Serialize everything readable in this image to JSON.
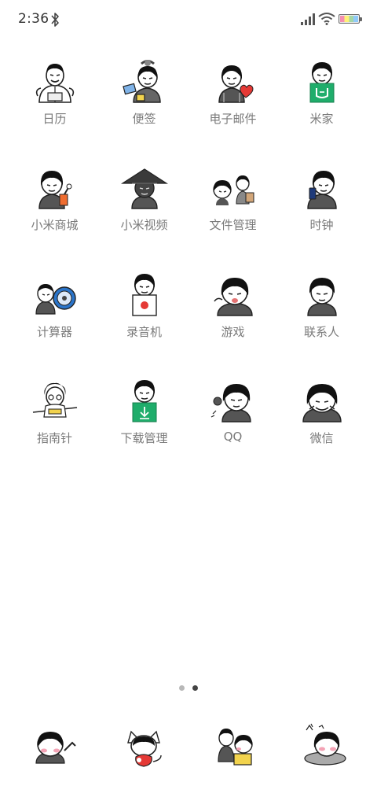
{
  "status_bar": {
    "time": "2:36",
    "icons": [
      "bluetooth-icon",
      "signal-icon",
      "wifi-icon",
      "battery-icon"
    ]
  },
  "apps": [
    {
      "label": "日历",
      "icon": "calendar-app-icon"
    },
    {
      "label": "便签",
      "icon": "notes-app-icon"
    },
    {
      "label": "电子邮件",
      "icon": "email-app-icon"
    },
    {
      "label": "米家",
      "icon": "mijia-app-icon"
    },
    {
      "label": "小米商城",
      "icon": "mi-store-app-icon"
    },
    {
      "label": "小米视频",
      "icon": "mi-video-app-icon"
    },
    {
      "label": "文件管理",
      "icon": "file-manager-app-icon"
    },
    {
      "label": "时钟",
      "icon": "clock-app-icon"
    },
    {
      "label": "计算器",
      "icon": "calculator-app-icon"
    },
    {
      "label": "录音机",
      "icon": "recorder-app-icon"
    },
    {
      "label": "游戏",
      "icon": "games-app-icon"
    },
    {
      "label": "联系人",
      "icon": "contacts-app-icon"
    },
    {
      "label": "指南针",
      "icon": "compass-app-icon"
    },
    {
      "label": "下载管理",
      "icon": "downloads-app-icon"
    },
    {
      "label": "QQ",
      "icon": "qq-app-icon"
    },
    {
      "label": "微信",
      "icon": "wechat-app-icon"
    }
  ],
  "page_indicator": {
    "pages": 2,
    "current": 2
  },
  "dock": [
    "phone-dock-icon",
    "cat-dock-icon",
    "messages-dock-icon",
    "camera-dock-icon"
  ],
  "colors": {
    "label": "#7a7a7a",
    "accent_green": "#1fad6b",
    "dot_inactive": "#b8b8b8",
    "dot_active": "#444444"
  }
}
